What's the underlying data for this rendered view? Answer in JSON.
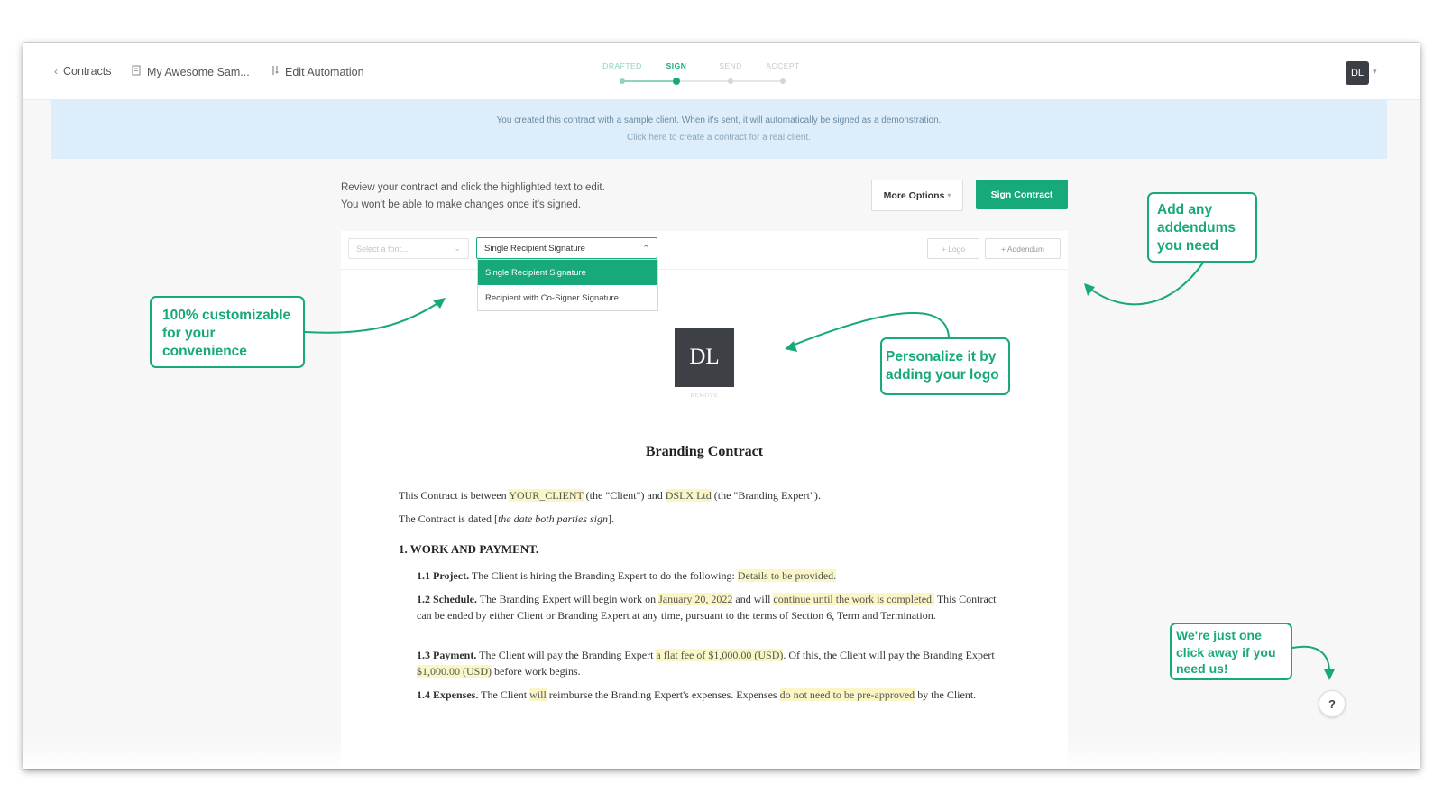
{
  "topbar": {
    "crumb_contracts": "Contracts",
    "crumb_document": "My Awesome Sam...",
    "crumb_automation": "Edit Automation",
    "steps": [
      {
        "label": "DRAFTED",
        "state": "done"
      },
      {
        "label": "SIGN",
        "state": "active"
      },
      {
        "label": "SEND",
        "state": "pending"
      },
      {
        "label": "ACCEPT",
        "state": "pending"
      }
    ],
    "avatar_initials": "DL"
  },
  "banner": {
    "line1": "You created this contract with a sample client. When it's sent, it will automatically be signed as a demonstration.",
    "line2": "Click here to create a contract for a real client."
  },
  "review": {
    "line1": "Review your contract and click the highlighted text to edit.",
    "line2": "You won't be able to make changes once it's signed."
  },
  "actions": {
    "more_options": "More Options",
    "sign_contract": "Sign Contract"
  },
  "toolbar": {
    "font_placeholder": "Select a font...",
    "signature_selected": "Single Recipient Signature",
    "signature_options": [
      "Single Recipient Signature",
      "Recipient with Co-Signer Signature"
    ],
    "logo_button": "+ Logo",
    "addendum_button": "+ Addendum"
  },
  "document": {
    "logo_initials": "DL",
    "logo_remove": "REMOVE",
    "title": "Branding Contract",
    "intro": {
      "t1": "This Contract is between ",
      "client": "YOUR_CLIENT",
      "t2": " (the \"Client\") and ",
      "company": "DSLX Ltd",
      "t3": " (the \"Branding Expert\")."
    },
    "dated": {
      "t1": "The Contract is dated [",
      "date": "the date both parties sign",
      "t2": "]."
    },
    "section1_title": "1. WORK AND PAYMENT.",
    "s11": {
      "label": "1.1 Project.",
      "t1": " The Client is hiring the Branding Expert to do the following: ",
      "hl": "Details to be provided."
    },
    "s12": {
      "label": "1.2 Schedule.",
      "t1": " The Branding Expert will begin work on ",
      "hl1": "January 20, 2022",
      "t2": " and will ",
      "hl2": "continue until the work is completed.",
      "t3": " This Contract can be ended by either Client or Branding Expert at any time, pursuant to the terms of Section 6, Term and Termination."
    },
    "s13": {
      "label": "1.3 Payment.",
      "t1": " The Client will pay the Branding Expert ",
      "hl1": "a flat fee of $1,000.00 (USD)",
      "t2": ". Of this, the Client will pay the Branding Expert ",
      "hl2": "$1,000.00 (USD)",
      "t3": " before work begins."
    },
    "s14": {
      "label": "1.4 Expenses.",
      "t1": " The Client ",
      "hl1": "will",
      "t2": " reimburse the Branding Expert's expenses. Expenses ",
      "hl2": "do not need to be pre-approved",
      "t3": " by the Client."
    }
  },
  "callouts": {
    "customizable": [
      "100% customizable",
      "for your",
      "convenience"
    ],
    "addendums": [
      "Add any",
      "addendums",
      "you need"
    ],
    "logo": [
      "Personalize it by",
      "adding your logo"
    ],
    "oneclick": [
      "We're just one",
      "click away if you",
      "need us!"
    ]
  },
  "help_label": "?",
  "colors": {
    "brand_green": "#17a87b",
    "banner_blue": "#ddeefa",
    "highlight": "#fbf6c6",
    "avatar_dark": "#3b3f45"
  }
}
